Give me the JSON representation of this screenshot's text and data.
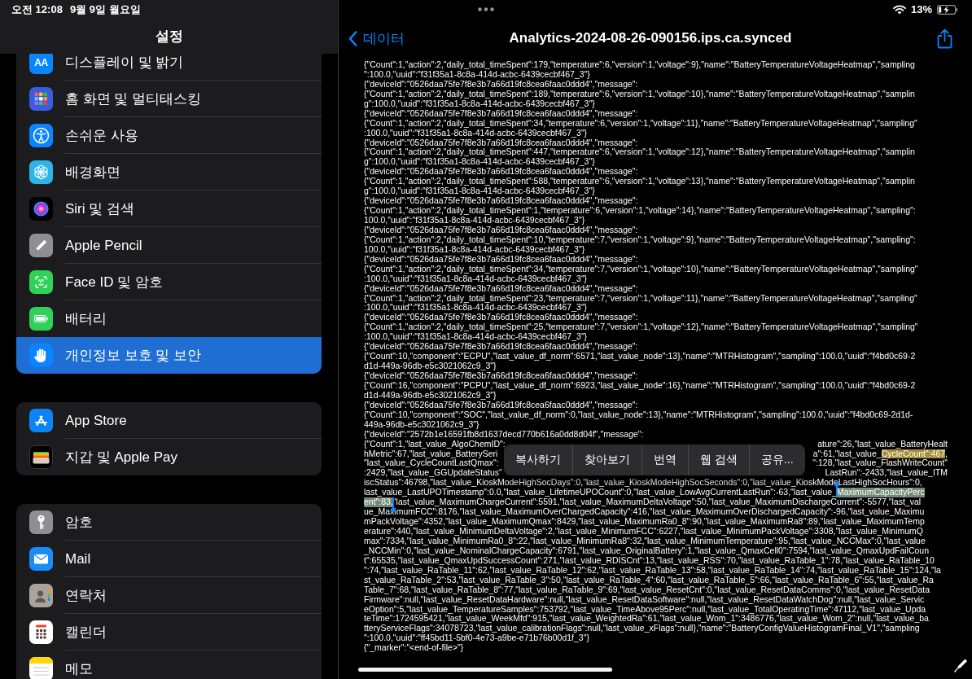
{
  "status_bar": {
    "time": "오전 12:08",
    "date": "9월 9일 월요일",
    "battery_percent": "13%",
    "charging": true
  },
  "settings": {
    "title": "설정",
    "groups": [
      {
        "items": [
          {
            "label": "디스플레이 및 밝기",
            "icon_text": "AA",
            "selected": false
          },
          {
            "label": "홈 화면 및 멀티태스킹",
            "selected": false
          },
          {
            "label": "손쉬운 사용",
            "selected": false
          },
          {
            "label": "배경화면",
            "selected": false
          },
          {
            "label": "Siri 및 검색",
            "selected": false
          },
          {
            "label": "Apple Pencil",
            "selected": false
          },
          {
            "label": "Face ID 및 암호",
            "selected": false
          },
          {
            "label": "배터리",
            "selected": false
          },
          {
            "label": "개인정보 보호 및 보안",
            "selected": true
          }
        ]
      },
      {
        "items": [
          {
            "label": "App Store",
            "selected": false
          },
          {
            "label": "지갑 및 Apple Pay",
            "selected": false
          }
        ]
      },
      {
        "items": [
          {
            "label": "암호",
            "selected": false
          },
          {
            "label": "Mail",
            "selected": false
          },
          {
            "label": "연락처",
            "selected": false
          },
          {
            "label": "캘린더",
            "selected": false
          },
          {
            "label": "메모",
            "selected": false
          }
        ]
      }
    ]
  },
  "document": {
    "back": "데이터",
    "title": "Analytics-2024-08-26-090156.ips.ca.synced",
    "lines": [
      {
        "text": "{\"Count\":1,\"action\":2,\"daily_total_timeSpent\":179,\"temperature\":6,\"version\":1,\"voltage\":9},\"name\":\"BatteryTemperatureVoltageHeatmap\",\"sampling"
      },
      {
        "text": "\":100.0,\"uuid\":\"f31f35a1-8c8a-414d-acbc-6439cecbf467_3\"}"
      },
      {
        "text": "{\"deviceId\":\"0526daa75fe7f8e3b7a66d19fc8cea6faac0ddd4\",\"message\":"
      },
      {
        "text": "{\"Count\":1,\"action\":2,\"daily_total_timeSpent\":189,\"temperature\":6,\"version\":1,\"voltage\":10},\"name\":\"BatteryTemperatureVoltageHeatmap\",\"samplin"
      },
      {
        "text": "g\":100.0,\"uuid\":\"f31f35a1-8c8a-414d-acbc-6439cecbf467_3\"}"
      },
      {
        "text": "{\"deviceId\":\"0526daa75fe7f8e3b7a66d19fc8cea6faac0ddd4\",\"message\":"
      },
      {
        "text": "{\"Count\":1,\"action\":2,\"daily_total_timeSpent\":34,\"temperature\":6,\"version\":1,\"voltage\":11},\"name\":\"BatteryTemperatureVoltageHeatmap\",\"sampling\""
      },
      {
        "text": ":100.0,\"uuid\":\"f31f35a1-8c8a-414d-acbc-6439cecbf467_3\"}"
      },
      {
        "text": "{\"deviceId\":\"0526daa75fe7f8e3b7a66d19fc8cea6faac0ddd4\",\"message\":"
      },
      {
        "text": "{\"Count\":1,\"action\":2,\"daily_total_timeSpent\":447,\"temperature\":6,\"version\":1,\"voltage\":12},\"name\":\"BatteryTemperatureVoltageHeatmap\",\"samplin"
      },
      {
        "text": "g\":100.0,\"uuid\":\"f31f35a1-8c8a-414d-acbc-6439cecbf467_3\"}"
      },
      {
        "text": "{\"deviceId\":\"0526daa75fe7f8e3b7a66d19fc8cea6faac0ddd4\",\"message\":"
      },
      {
        "text": "{\"Count\":1,\"action\":2,\"daily_total_timeSpent\":588,\"temperature\":6,\"version\":1,\"voltage\":13},\"name\":\"BatteryTemperatureVoltageHeatmap\",\"samplin"
      },
      {
        "text": "g\":100.0,\"uuid\":\"f31f35a1-8c8a-414d-acbc-6439cecbf467_3\"}"
      },
      {
        "text": "{\"deviceId\":\"0526daa75fe7f8e3b7a66d19fc8cea6faac0ddd4\",\"message\":"
      },
      {
        "text": "{\"Count\":1,\"action\":2,\"daily_total_timeSpent\":1,\"temperature\":6,\"version\":1,\"voltage\":14},\"name\":\"BatteryTemperatureVoltageHeatmap\",\"sampling\":"
      },
      {
        "text": "100.0,\"uuid\":\"f31f35a1-8c8a-414d-acbc-6439cecbf467_3\"}"
      },
      {
        "text": "{\"deviceId\":\"0526daa75fe7f8e3b7a66d19fc8cea6faac0ddd4\",\"message\":"
      },
      {
        "text": "{\"Count\":1,\"action\":2,\"daily_total_timeSpent\":10,\"temperature\":7,\"version\":1,\"voltage\":9},\"name\":\"BatteryTemperatureVoltageHeatmap\",\"sampling\":"
      },
      {
        "text": "100.0,\"uuid\":\"f31f35a1-8c8a-414d-acbc-6439cecbf467_3\"}"
      },
      {
        "text": "{\"deviceId\":\"0526daa75fe7f8e3b7a66d19fc8cea6faac0ddd4\",\"message\":"
      },
      {
        "text": "{\"Count\":1,\"action\":2,\"daily_total_timeSpent\":34,\"temperature\":7,\"version\":1,\"voltage\":10},\"name\":\"BatteryTemperatureVoltageHeatmap\",\"sampling\""
      },
      {
        "text": ":100.0,\"uuid\":\"f31f35a1-8c8a-414d-acbc-6439cecbf467_3\"}"
      },
      {
        "text": "{\"deviceId\":\"0526daa75fe7f8e3b7a66d19fc8cea6faac0ddd4\",\"message\":"
      },
      {
        "text": "{\"Count\":1,\"action\":2,\"daily_total_timeSpent\":23,\"temperature\":7,\"version\":1,\"voltage\":11},\"name\":\"BatteryTemperatureVoltageHeatmap\",\"sampling\""
      },
      {
        "text": ":100.0,\"uuid\":\"f31f35a1-8c8a-414d-acbc-6439cecbf467_3\"}"
      },
      {
        "text": "{\"deviceId\":\"0526daa75fe7f8e3b7a66d19fc8cea6faac0ddd4\",\"message\":"
      },
      {
        "text": "{\"Count\":1,\"action\":2,\"daily_total_timeSpent\":25,\"temperature\":7,\"version\":1,\"voltage\":12},\"name\":\"BatteryTemperatureVoltageHeatmap\",\"sampling\""
      },
      {
        "text": ":100.0,\"uuid\":\"f31f35a1-8c8a-414d-acbc-6439cecbf467_3\"}"
      },
      {
        "text": "{\"deviceId\":\"0526daa75fe7f8e3b7a66d19fc8cea6faac0ddd4\",\"message\":"
      },
      {
        "text": "{\"Count\":10,\"component\":\"ECPU\",\"last_value_df_norm\":6571,\"last_value_node\":13},\"name\":\"MTRHistogram\",\"sampling\":100.0,\"uuid\":\"f4bd0c69-2"
      },
      {
        "text": "d1d-449a-96db-e5c3021062c9_3\"}"
      },
      {
        "text": "{\"deviceId\":\"0526daa75fe7f8e3b7a66d19fc8cea6faac0ddd4\",\"message\":"
      },
      {
        "text": "{\"Count\":16,\"component\":\"PCPU\",\"last_value_df_norm\":6923,\"last_value_node\":16},\"name\":\"MTRHistogram\",\"sampling\":100.0,\"uuid\":\"f4bd0c69-2"
      },
      {
        "text": "d1d-449a-96db-e5c3021062c9_3\"}"
      },
      {
        "text": "{\"deviceId\":\"0526daa75fe7f8e3b7a66d19fc8cea6faac0ddd4\",\"message\":"
      },
      {
        "text": "{\"Count\":10,\"component\":\"SOC\",\"last_value_df_norm\":0,\"last_value_node\":13},\"name\":\"MTRHistogram\",\"sampling\":100.0,\"uuid\":\"f4bd0c69-2d1d-"
      },
      {
        "text": "449a-96db-e5c3021062c9_3\"}"
      },
      {
        "text": "{\"deviceId\":\"2572b1e16591fb8d1637decd770b616a0dd8d04f\",\"message\":"
      },
      {
        "segments": [
          [
            {
              "text": "{\"Count\":1,\"last_value_AlgoChemID\":",
              "highlighted": false,
              "selected": false
            }
          ],
          [
            {
              "text": "ature\":26,\"last_value_BatteryHealt",
              "highlighted": false,
              "selected": false
            }
          ]
        ]
      },
      {
        "segments": [
          [
            {
              "text": "hMetric\":67,\"last_value_BatterySeri",
              "highlighted": false,
              "selected": false
            }
          ],
          [
            {
              "text": "a\":61,\"last_value_",
              "highlighted": false,
              "selected": false
            },
            {
              "text": "CycleCount\":467",
              "highlighted": true,
              "selected": false
            },
            {
              "text": ",",
              "highlighted": false,
              "selected": false
            }
          ]
        ]
      },
      {
        "segments": [
          [
            {
              "text": "\"last_value_CycleCountLastQmax\":",
              "highlighted": false,
              "selected": false
            }
          ],
          [
            {
              "text": "\":128,\"last_value_FlashWriteCount\"",
              "highlighted": false,
              "selected": false
            }
          ]
        ]
      },
      {
        "segments": [
          [
            {
              "text": ":2429,\"last_value_GGUpdateStatus\"",
              "highlighted": false,
              "selected": false
            }
          ],
          [
            {
              "text": "LastRun\":-2433,\"last_value_ITM",
              "highlighted": false,
              "selected": false
            }
          ]
        ]
      },
      {
        "text": "iscStatus\":46798,\"last_value_KioskModeHighSocDays\":0,\"last_value_KioskModeHighSocSeconds\":0,\"last_value_KioskModeLastHighSocHours\":0,"
      },
      {
        "segments": [
          [
            {
              "text": "last_value_LastUPOTimestamp\":0.0,\"last_value_LifetimeUPOCount\":0,\"last_value_LowAvgCurrentLastRun\":-63,\"last_value_",
              "highlighted": false,
              "selected": false
            },
            {
              "text": "MaximumCapacityPerc",
              "highlighted": true,
              "selected": true
            }
          ]
        ]
      },
      {
        "segments": [
          [
            {
              "text": "ent\":83,",
              "highlighted": true,
              "selected": true
            },
            {
              "text": "\"last_value_MaximumChargeCurrent\":5591,\"last_value_MaximumDeltaVoltage\":50,\"last_value_MaximumDischargeCurrent\":-5577,\"last_val",
              "highlighted": false,
              "selected": false
            }
          ]
        ]
      },
      {
        "text": "ue_MaximumFCC\":8176,\"last_value_MaximumOverChargedCapacity\":416,\"last_value_MaximumOverDischargedCapacity\":-96,\"last_value_Maximu"
      },
      {
        "text": "mPackVoltage\":4352,\"last_value_MaximumQmax\":8429,\"last_value_MaximumRa0_8\":90,\"last_value_MaximumRa8\":89,\"last_value_MaximumTemp"
      },
      {
        "text": "erature\":440,\"last_value_MinimumDeltaVoltage\":2,\"last_value_MinimumFCC\":6227,\"last_value_MinimumPackVoltage\":3308,\"last_value_MinimumQ"
      },
      {
        "text": "max\":7334,\"last_value_MinimumRa0_8\":22,\"last_value_MinimumRa8\":32,\"last_value_MinimumTemperature\":95,\"last_value_NCCMax\":0,\"last_value"
      },
      {
        "text": "_NCCMin\":0,\"last_value_NominalChargeCapacity\":6791,\"last_value_OriginalBattery\":1,\"last_value_QmaxCell0\":7594,\"last_value_QmaxUpdFailCoun"
      },
      {
        "text": "t\":65535,\"last_value_QmaxUpdSuccessCount\":271,\"last_value_RDISCnt\":13,\"last_value_RSS\":70,\"last_value_RaTable_1\":78,\"last_value_RaTable_10"
      },
      {
        "text": "\":74,\"last_value_RaTable_11\":62,\"last_value_RaTable_12\":62,\"last_value_RaTable_13\":58,\"last_value_RaTable_14\":74,\"last_value_RaTable_15\":124,\"la"
      },
      {
        "text": "st_value_RaTable_2\":53,\"last_value_RaTable_3\":50,\"last_value_RaTable_4\":60,\"last_value_RaTable_5\":66,\"last_value_RaTable_6\":55,\"last_value_Ra"
      },
      {
        "text": "Table_7\":68,\"last_value_RaTable_8\":77,\"last_value_RaTable_9\":69,\"last_value_ResetCnt\":0,\"last_value_ResetDataComms\":0,\"last_value_ResetData"
      },
      {
        "text": "Firmware\":null,\"last_value_ResetDataHardware\":null,\"last_value_ResetDataSoftware\":null,\"last_value_ResetDataWatchDog\":null,\"last_value_Servic"
      },
      {
        "text": "eOption\":5,\"last_value_TemperatureSamples\":753792,\"last_value_TimeAbove95Perc\":null,\"last_value_TotalOperatingTime\":47112,\"last_value_Upda"
      },
      {
        "text": "teTime\":1724595421,\"last_value_WeekMfd\":915,\"last_value_WeightedRa\":61,\"last_value_Wom_1\":3486776,\"last_value_Wom_2\":null,\"last_value_ba"
      },
      {
        "text": "tteryServiceFlags\":34078723,\"last_value_calibrationFlags\":null,\"last_value_xFlags\":null},\"name\":\"BatteryConfigValueHistogramFinal_V1\",\"sampling"
      },
      {
        "text": "\":100.0,\"uuid\":\"ff45bd11-5bf0-4e73-a9be-e71b76b00d1f_3\"}"
      },
      {
        "text": "{\"_marker\":\"<end-of-file>\"}"
      }
    ]
  },
  "context_menu": {
    "items": [
      "복사하기",
      "찾아보기",
      "번역",
      "웹 검색",
      "공유..."
    ]
  }
}
